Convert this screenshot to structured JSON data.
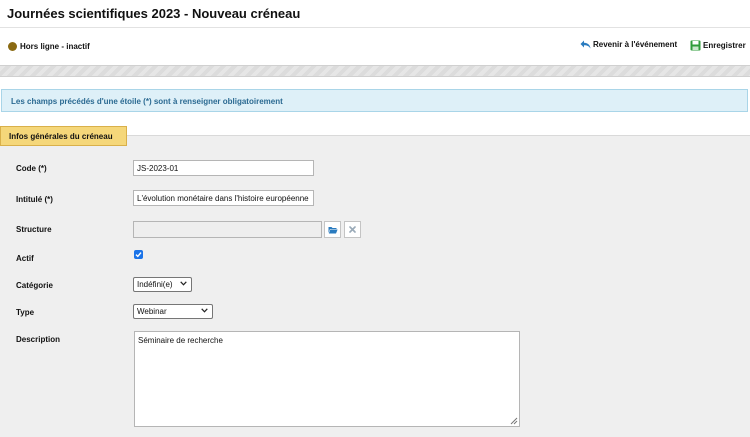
{
  "header": {
    "title": "Journées scientifiques 2023 - Nouveau créneau"
  },
  "status": {
    "label": "Hors ligne - inactif",
    "color": "#8a6a12"
  },
  "toolbar": {
    "back_label": "Revenir à l'événement",
    "save_label": "Enregistrer"
  },
  "notice": {
    "text": "Les champs précédés d'une étoile (*) sont à renseigner obligatoirement"
  },
  "section": {
    "title": "Infos générales du créneau"
  },
  "form": {
    "code_label": "Code (*)",
    "code_value": "JS-2023-01",
    "intitule_label": "Intitulé (*)",
    "intitule_value": "L'évolution monétaire dans l'histoire européenne",
    "structure_label": "Structure",
    "structure_value": "",
    "actif_label": "Actif",
    "actif_checked": true,
    "categorie_label": "Catégorie",
    "categorie_value": "Indéfini(e)",
    "type_label": "Type",
    "type_value": "Webinar",
    "description_label": "Description",
    "description_value": "Séminaire de recherche"
  },
  "colors": {
    "accent_tab": "#f5d77a",
    "notice_bg": "#def0f8",
    "notice_text": "#2b6a92",
    "checkbox": "#1a73e8"
  }
}
